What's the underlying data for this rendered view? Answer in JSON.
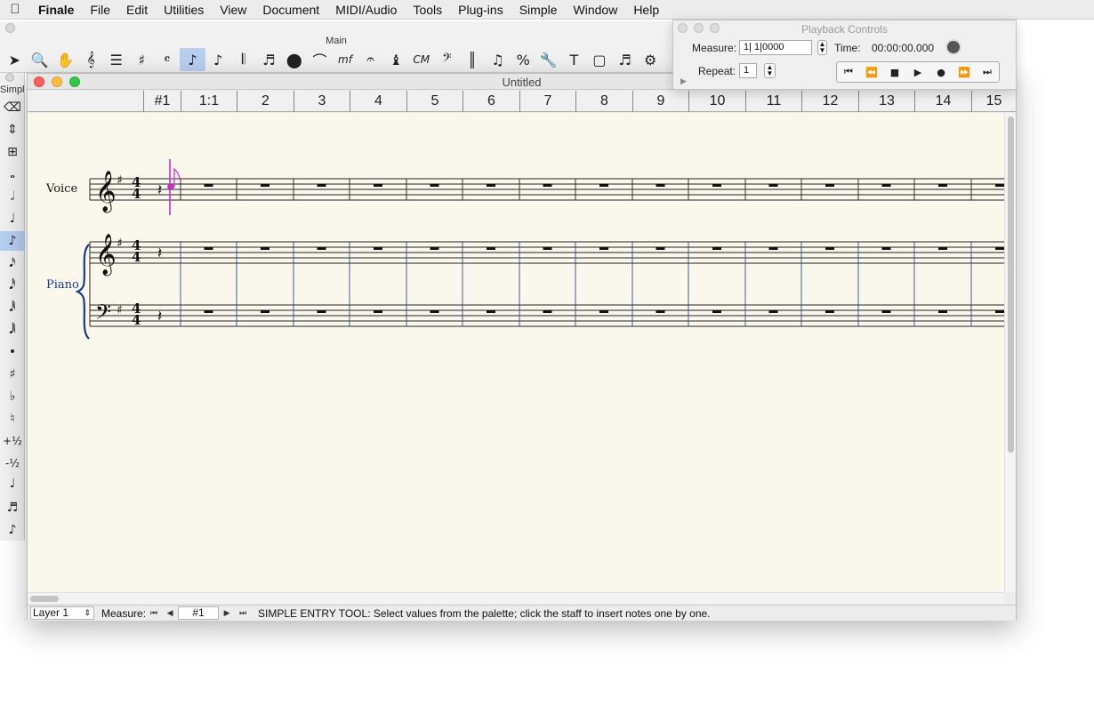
{
  "menubar": {
    "apple_icon": "apple-icon",
    "app_name": "Finale",
    "items": [
      "File",
      "Edit",
      "Utilities",
      "View",
      "Document",
      "MIDI/Audio",
      "Tools",
      "Plug-ins",
      "Simple",
      "Window",
      "Help"
    ]
  },
  "main_palette": {
    "title": "Main",
    "tools": [
      {
        "name": "selection-tool-icon",
        "glyph": "➤"
      },
      {
        "name": "zoom-tool-icon",
        "glyph": "🔍"
      },
      {
        "name": "hand-grabber-icon",
        "glyph": "✋"
      },
      {
        "name": "staff-tool-icon",
        "glyph": "𝄞"
      },
      {
        "name": "measure-tool-icon",
        "glyph": "☰"
      },
      {
        "name": "key-signature-tool-icon",
        "glyph": "♯"
      },
      {
        "name": "time-signature-tool-icon",
        "glyph": "𝄴"
      },
      {
        "name": "simple-entry-tool-icon",
        "glyph": "♪",
        "selected": true
      },
      {
        "name": "speedy-entry-tool-icon",
        "glyph": "♪"
      },
      {
        "name": "hyperscribe-tool-icon",
        "glyph": "𝄃"
      },
      {
        "name": "tuplet-tool-icon",
        "glyph": "♬"
      },
      {
        "name": "smart-shape-tool-icon",
        "glyph": "⬤"
      },
      {
        "name": "articulation-tool-icon",
        "glyph": "⌒"
      },
      {
        "name": "expression-tool-icon",
        "glyph": "mf"
      },
      {
        "name": "repeat-tool-icon",
        "glyph": "𝄐"
      },
      {
        "name": "lyrics-tool-icon",
        "glyph": "♝"
      },
      {
        "name": "chord-tool-icon",
        "glyph": "CM"
      },
      {
        "name": "clef-tool-icon",
        "glyph": "𝄢"
      },
      {
        "name": "mirror-tool-icon",
        "glyph": "║"
      },
      {
        "name": "special-tools-icon",
        "glyph": "♫"
      },
      {
        "name": "percussion-tool-icon",
        "glyph": "%"
      },
      {
        "name": "wrench-tool-icon",
        "glyph": "🔧"
      },
      {
        "name": "text-tool-icon",
        "glyph": "T"
      },
      {
        "name": "graphics-tool-icon",
        "glyph": "▢"
      },
      {
        "name": "staff-styles-icon",
        "glyph": "♬"
      },
      {
        "name": "plug-in-icon",
        "glyph": "⚙"
      }
    ]
  },
  "side_palette": {
    "title": "Simple",
    "tools": [
      {
        "name": "eraser-icon",
        "glyph": "⌫"
      },
      {
        "name": "tie-icon",
        "glyph": "⇕"
      },
      {
        "name": "invert-icon",
        "glyph": "⊞"
      },
      {
        "name": "whole-note-icon",
        "glyph": "𝅝"
      },
      {
        "name": "half-note-icon",
        "glyph": "𝅗𝅥"
      },
      {
        "name": "quarter-note-icon",
        "glyph": "♩"
      },
      {
        "name": "eighth-note-icon",
        "glyph": "♪",
        "selected": true
      },
      {
        "name": "sixteenth-note-icon",
        "glyph": "𝅘𝅥𝅯"
      },
      {
        "name": "thirty-second-note-icon",
        "glyph": "𝅘𝅥𝅰"
      },
      {
        "name": "sixty-fourth-note-icon",
        "glyph": "𝅘𝅥𝅱"
      },
      {
        "name": "one-twenty-eighth-note-icon",
        "glyph": "𝅘𝅥𝅲"
      },
      {
        "name": "dot-icon",
        "glyph": "•"
      },
      {
        "name": "sharp-icon",
        "glyph": "♯"
      },
      {
        "name": "flat-icon",
        "glyph": "♭"
      },
      {
        "name": "natural-icon",
        "glyph": "♮"
      },
      {
        "name": "raise-half-step-icon",
        "glyph": "+½"
      },
      {
        "name": "lower-half-step-icon",
        "glyph": "-½"
      },
      {
        "name": "tie-notes-icon",
        "glyph": "♩"
      },
      {
        "name": "tuplet-icon",
        "glyph": "♬"
      },
      {
        "name": "grace-note-icon",
        "glyph": "♪"
      }
    ]
  },
  "document": {
    "title": "Untitled",
    "ruler": [
      "#1",
      "1:1",
      "2",
      "3",
      "4",
      "5",
      "6",
      "7",
      "8",
      "9",
      "10",
      "11",
      "12",
      "13",
      "14",
      "15"
    ],
    "staves": [
      "Voice",
      "Piano"
    ]
  },
  "status_bar": {
    "layer": "Layer 1",
    "measure_label": "Measure:",
    "measure_value": "#1",
    "message": "SIMPLE ENTRY TOOL: Select values from the palette; click the staff to insert notes one by one."
  },
  "playback": {
    "title": "Playback Controls",
    "measure_label": "Measure:",
    "measure_value": "1| 1|0000",
    "time_label": "Time:",
    "time_value": "00:00:00.000",
    "repeat_label": "Repeat:",
    "repeat_value": "1"
  },
  "colors": {
    "accent": "#b8cff0",
    "insertion": "#d12ad1",
    "staff_line": "#222222",
    "barline_blue": "#2d4a8a"
  }
}
